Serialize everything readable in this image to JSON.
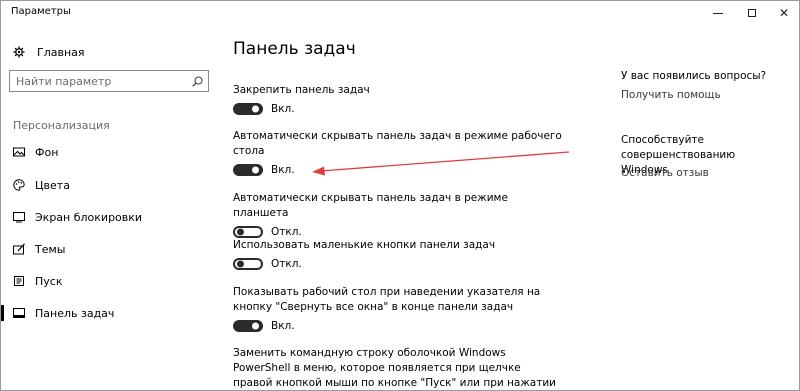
{
  "window": {
    "title": "Параметры",
    "minimize_glyph": "—",
    "close_glyph": "✕"
  },
  "sidebar": {
    "home_label": "Главная",
    "search_placeholder": "Найти параметр",
    "section_label": "Персонализация",
    "items": [
      {
        "label": "Фон",
        "icon": "picture-icon"
      },
      {
        "label": "Цвета",
        "icon": "palette-icon"
      },
      {
        "label": "Экран блокировки",
        "icon": "lock-screen-icon"
      },
      {
        "label": "Темы",
        "icon": "brush-icon"
      },
      {
        "label": "Пуск",
        "icon": "start-icon"
      },
      {
        "label": "Панель задач",
        "icon": "taskbar-icon",
        "active": true
      }
    ]
  },
  "main": {
    "title": "Панель задач",
    "settings": [
      {
        "label": "Закрепить панель задач",
        "state": "on",
        "state_label": "Вкл."
      },
      {
        "label": "Автоматически скрывать панель задач в режиме рабочего стола",
        "state": "on",
        "state_label": "Вкл."
      },
      {
        "label": "Автоматически скрывать панель задач в режиме планшета",
        "state": "off",
        "state_label": "Откл."
      },
      {
        "label": "Использовать маленькие кнопки панели задач",
        "state": "off",
        "state_label": "Откл."
      },
      {
        "label": "Показывать рабочий стол при наведении указателя на кнопку \"Свернуть все окна\" в конце панели задач",
        "state": "on",
        "state_label": "Вкл."
      },
      {
        "label": "Заменить командную строку оболочкой Windows PowerShell в меню, которое появляется при щелчке правой кнопкой мыши по кнопке \"Пуск\" или при нажатии клавиш Windows+X"
      }
    ]
  },
  "aside": {
    "question": "У вас появились вопросы?",
    "help_link": "Получить помощь",
    "improve_text": "Способствуйте совершенствованию Windows",
    "feedback_link": "Оставить отзыв"
  },
  "colors": {
    "toggle": "#2b2b2b",
    "annotation_arrow": "#e03c3c"
  }
}
